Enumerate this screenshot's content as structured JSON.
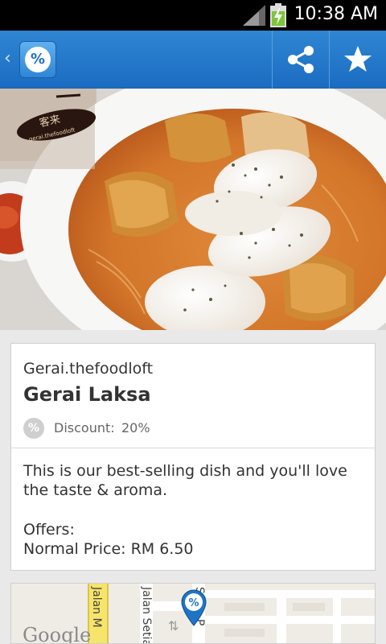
{
  "status_bar": {
    "time": "10:38 AM",
    "icons": [
      "signal-icon",
      "battery-charging-icon"
    ]
  },
  "action_bar": {
    "back_icon": "chevron-left-icon",
    "logo_glyph": "%",
    "actions": [
      "share-icon",
      "star-icon"
    ],
    "color": "#2378c9"
  },
  "hero": {
    "sign_text": "客来",
    "sign_subtext": "gerai.thefoodloft"
  },
  "card": {
    "vendor": "Gerai.thefoodloft",
    "title": "Gerai Laksa",
    "discount_icon_glyph": "%",
    "discount_label": "Discount:",
    "discount_value": "20%",
    "description": "This is our best-selling dish and you'll love the taste & aroma.",
    "offers_label": "Offers:",
    "price": "Normal Price: RM 6.50"
  },
  "map": {
    "streets": [
      "Jalan M",
      "Jalan Setia",
      "Setia P"
    ],
    "attribution": "Google",
    "pin_glyph": "%"
  }
}
